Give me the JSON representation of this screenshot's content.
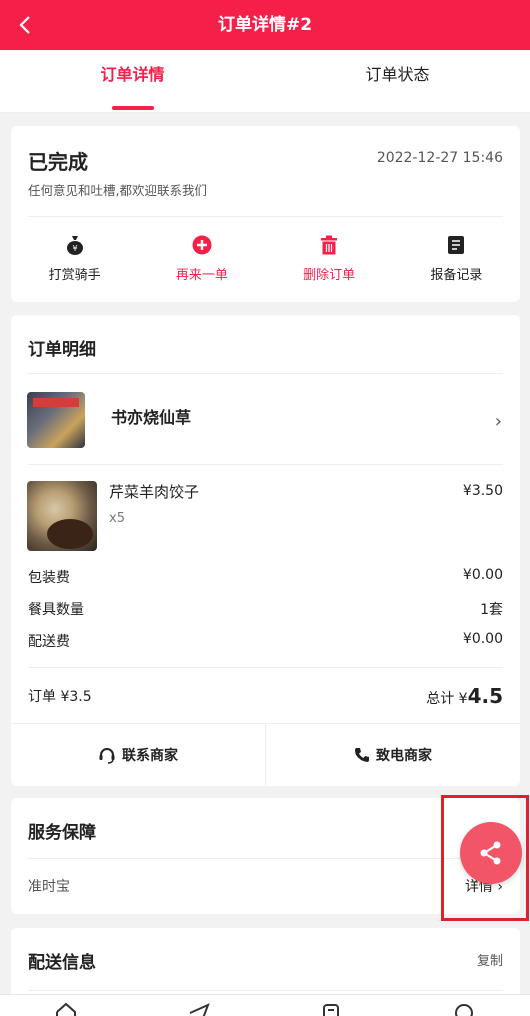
{
  "header": {
    "title": "订单详情#2",
    "back_icon": "chevron-left-icon"
  },
  "tabs": [
    {
      "label": "订单详情",
      "active": true
    },
    {
      "label": "订单状态",
      "active": false
    }
  ],
  "status": {
    "title": "已完成",
    "time": "2022-12-27 15:46",
    "subtitle": "任何意见和吐槽,都欢迎联系我们",
    "actions": [
      {
        "label": "打赏骑手",
        "icon": "money-bag-icon",
        "color": "#222222"
      },
      {
        "label": "再来一单",
        "icon": "plus-circle-icon",
        "color": "#f4204a"
      },
      {
        "label": "删除订单",
        "icon": "trash-icon",
        "color": "#f4204a"
      },
      {
        "label": "报备记录",
        "icon": "document-icon",
        "color": "#222222"
      }
    ]
  },
  "order": {
    "title": "订单明细",
    "shop_name": "书亦烧仙草",
    "item": {
      "name": "芹菜羊肉饺子",
      "qty": "x5",
      "price": "¥3.50"
    },
    "fees": [
      {
        "label": "包装费",
        "value": "¥0.00"
      },
      {
        "label": "餐具数量",
        "value": "1套"
      },
      {
        "label": "配送费",
        "value": "¥0.00"
      }
    ],
    "order_label": "订单 ¥3.5",
    "total_label": "总计 ¥",
    "total_value": "4.5",
    "contact_buttons": [
      {
        "label": "联系商家",
        "icon": "headset-icon"
      },
      {
        "label": "致电商家",
        "icon": "phone-icon"
      }
    ]
  },
  "service": {
    "title": "服务保障",
    "item": "准时宝",
    "detail": "详情 ›"
  },
  "delivery": {
    "title": "配送信息",
    "copy": "复制"
  },
  "bottom_nav": [
    "home-icon",
    "send-icon",
    "orders-icon",
    "profile-icon"
  ],
  "colors": {
    "brand": "#f4204a",
    "share": "#f25468",
    "highlight": "#e0202a"
  }
}
